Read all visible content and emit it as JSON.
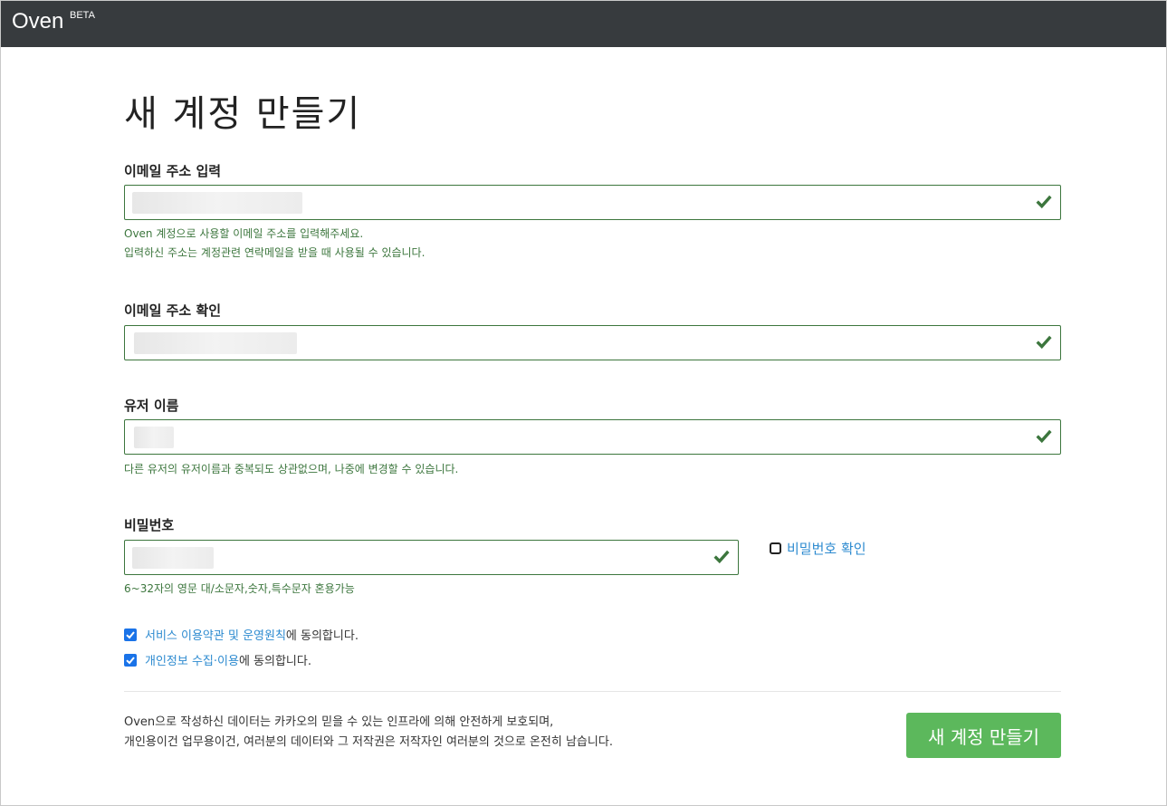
{
  "header": {
    "brand": "Oven",
    "badge": "BETA"
  },
  "title": "새 계정 만들기",
  "email": {
    "label": "이메일 주소 입력",
    "help_line1": "Oven 계정으로 사용할 이메일 주소를 입력해주세요.",
    "help_line2": "입력하신 주소는 계정관련 연락메일을 받을 때 사용될 수 있습니다."
  },
  "email_confirm": {
    "label": "이메일 주소 확인"
  },
  "username": {
    "label": "유저 이름",
    "help": "다른 유저의 유저이름과 중복되도 상관없으며, 나중에 변경할 수 있습니다."
  },
  "password": {
    "label": "비밀번호",
    "help": "6~32자의 영문 대/소문자,숫자,특수문자 혼용가능",
    "show_label": "비밀번호 확인"
  },
  "agreements": [
    {
      "link": "서비스 이용약관 및 운영원칙",
      "suffix": "에 동의합니다.",
      "checked": true
    },
    {
      "link": "개인정보 수집·이용",
      "suffix": "에 동의합니다.",
      "checked": true
    }
  ],
  "footer": {
    "line1": "Oven으로 작성하신 데이터는 카카오의 믿을 수 있는 인프라에 의해 안전하게 보호되며,",
    "line2": "개인용이건 업무용이건, 여러분의 데이터와 그 저작권은 저작자인 여러분의 것으로 온전히 남습니다."
  },
  "submit_label": "새 계정 만들기",
  "colors": {
    "valid": "#3c763d",
    "submit": "#5cb85c",
    "link": "#2e8bd0",
    "header": "#373b3e"
  }
}
